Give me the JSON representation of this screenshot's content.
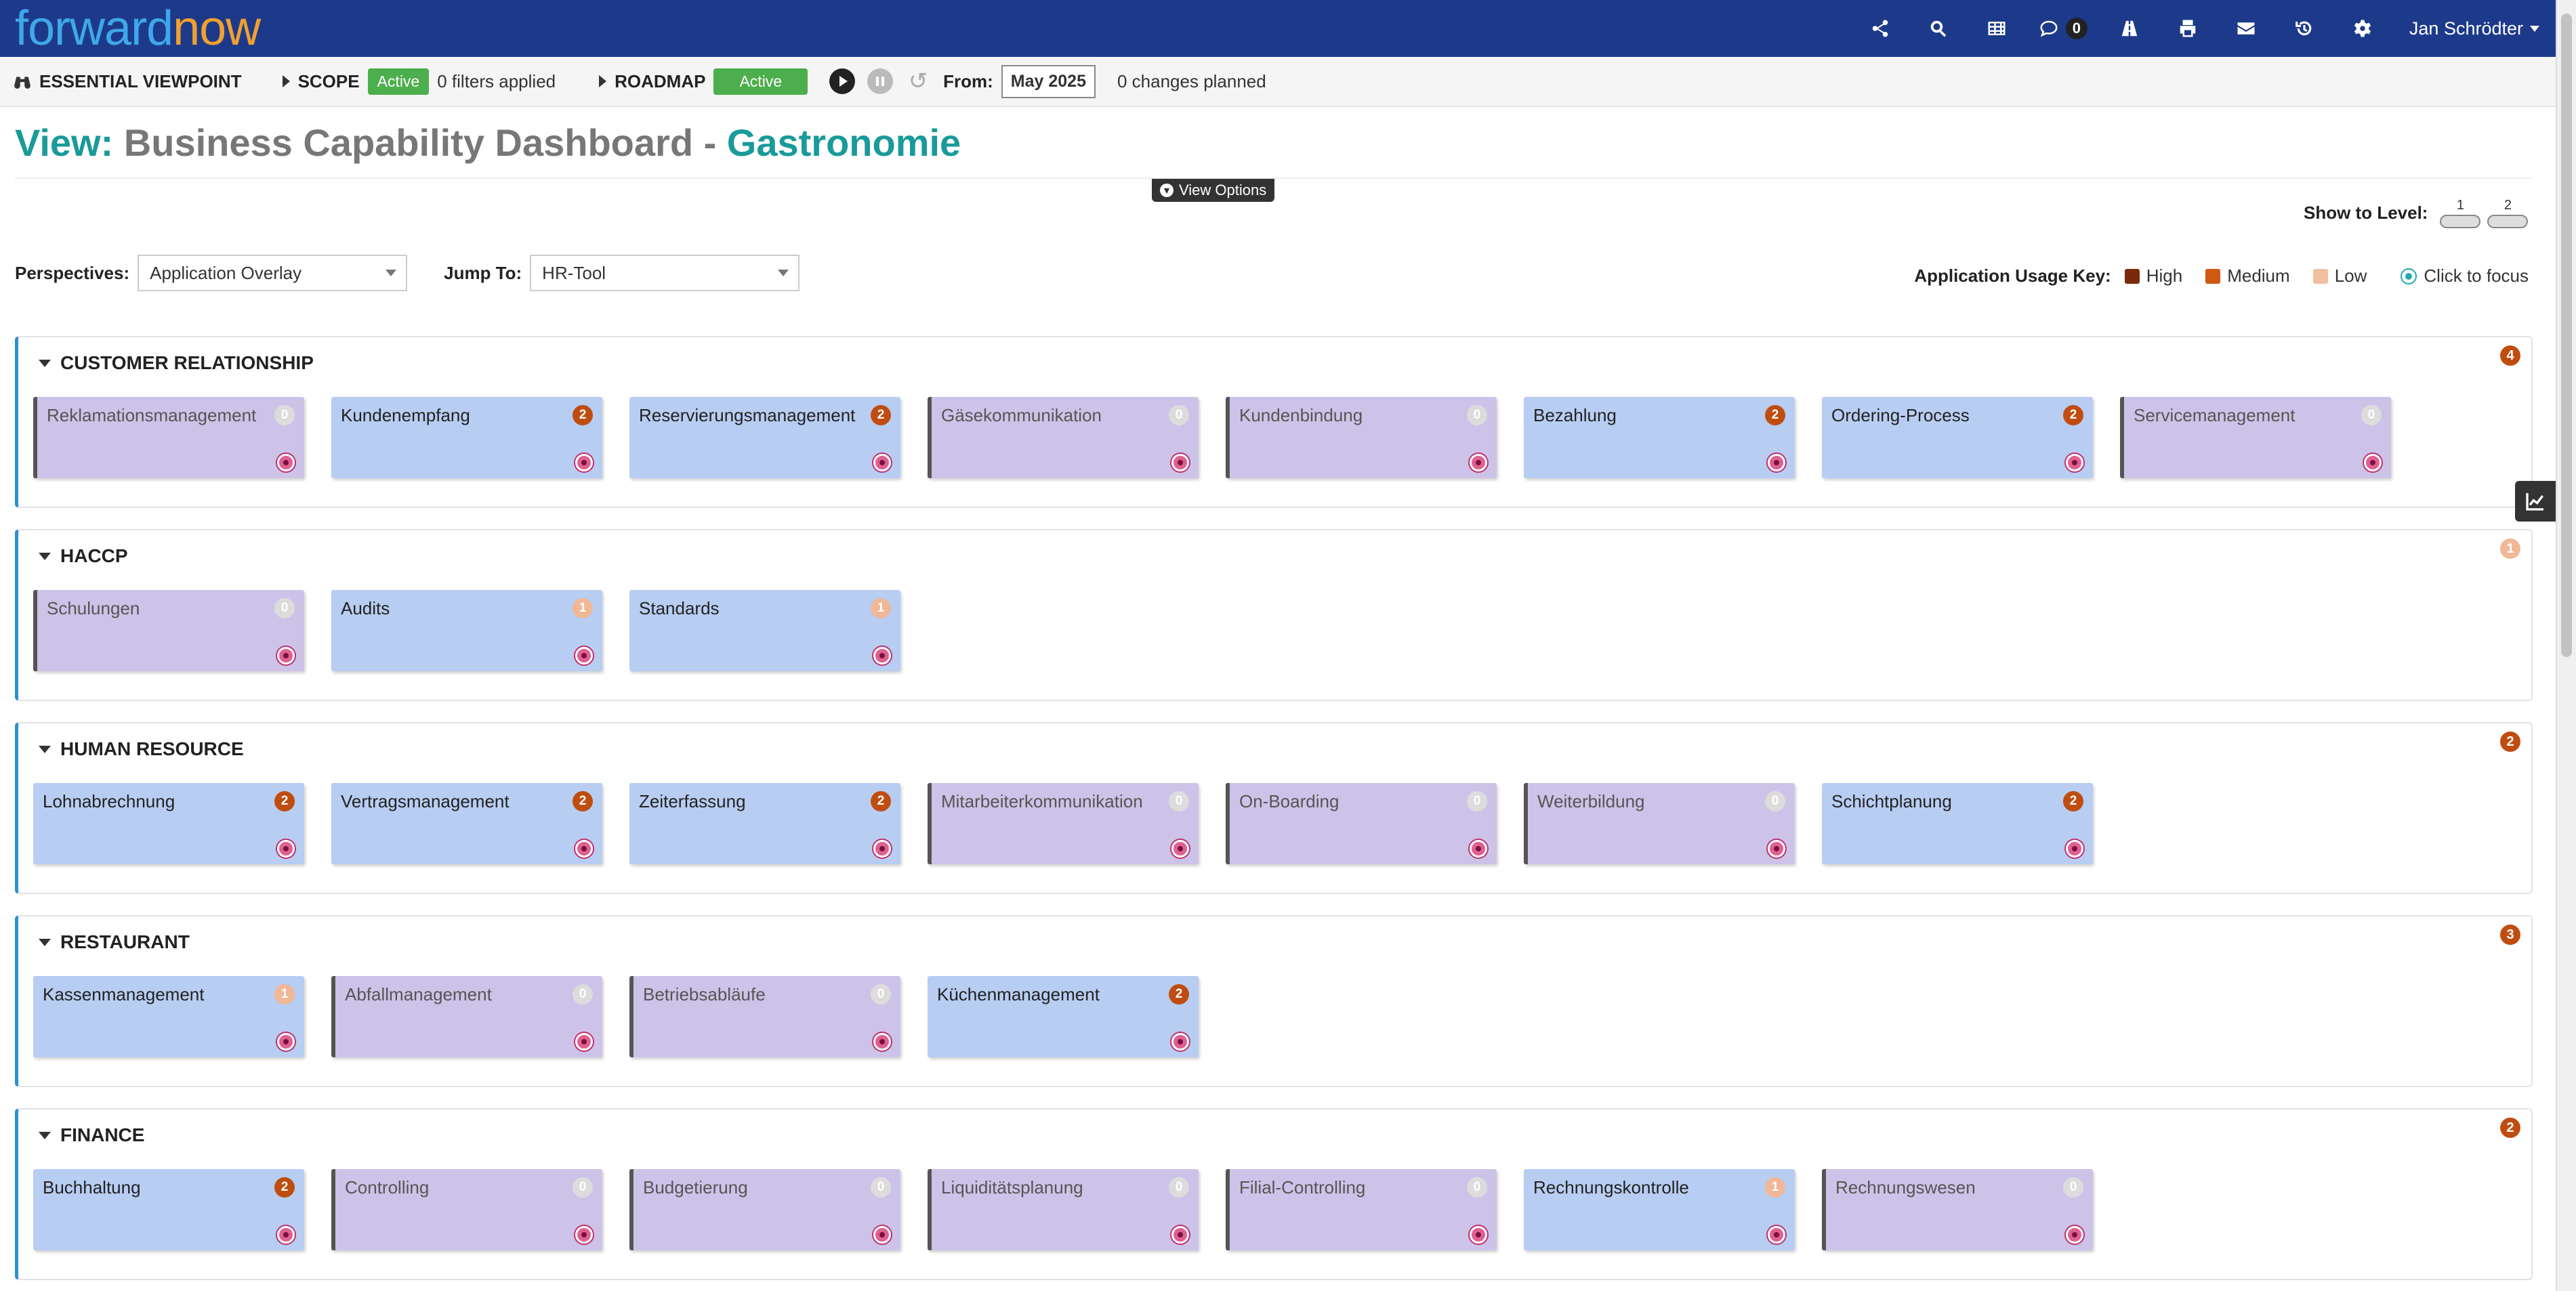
{
  "brand": {
    "part1": "forward",
    "part2": "now"
  },
  "topbar": {
    "icons": [
      "share-icon",
      "search-icon",
      "table-icon",
      "chat-icon",
      "road-icon",
      "print-icon",
      "mail-icon",
      "history-icon",
      "gear-icon"
    ],
    "chat_count": "0",
    "user_name": "Jan Schrödter"
  },
  "toolbar": {
    "viewpoint": "ESSENTIAL VIEWPOINT",
    "scope_label": "SCOPE",
    "scope_status": "Active",
    "filters_text": "0 filters applied",
    "roadmap_label": "ROADMAP",
    "roadmap_status": "Active",
    "from_label": "From:",
    "from_date": "May 2025",
    "changes_text": "0 changes planned"
  },
  "title": {
    "prefix": "View:",
    "name": "Business Capability Dashboard",
    "separator": " - ",
    "context": "Gastronomie"
  },
  "view_options_label": "View Options",
  "show_level": {
    "label": "Show to Level:",
    "levels": [
      "1",
      "2"
    ]
  },
  "filters": {
    "perspectives_label": "Perspectives:",
    "perspectives_value": "Application Overlay",
    "jump_label": "Jump To:",
    "jump_value": "HR-Tool"
  },
  "usage_key": {
    "label": "Application Usage Key:",
    "items": [
      {
        "label": "High",
        "color": "#7a2a0a"
      },
      {
        "label": "Medium",
        "color": "#d05a14"
      },
      {
        "label": "Low",
        "color": "#f0c0a0"
      }
    ],
    "focus_label": "Click to focus"
  },
  "colors": {
    "high": "#7a2a0a",
    "medium": "#c04d10",
    "low": "#f0b896",
    "zero": "#dcdcdc",
    "app": "#b8cdf2",
    "noapp": "#cdc3e8"
  },
  "sections": [
    {
      "title": "CUSTOMER RELATIONSHIP",
      "count": "4",
      "count_color": "#c04d10",
      "cards": [
        {
          "label": "Reklamationsmanagement",
          "count": "0",
          "apps": false
        },
        {
          "label": "Kundenempfang",
          "count": "2",
          "apps": true
        },
        {
          "label": "Reservierungsmanagement",
          "count": "2",
          "apps": true
        },
        {
          "label": "Gäsekommunikation",
          "count": "0",
          "apps": false
        },
        {
          "label": "Kundenbindung",
          "count": "0",
          "apps": false
        },
        {
          "label": "Bezahlung",
          "count": "2",
          "apps": true
        },
        {
          "label": "Ordering-Process",
          "count": "2",
          "apps": true
        },
        {
          "label": "Servicemanagement",
          "count": "0",
          "apps": false
        }
      ]
    },
    {
      "title": "HACCP",
      "count": "1",
      "count_color": "#f0b896",
      "cards": [
        {
          "label": "Schulungen",
          "count": "0",
          "apps": false
        },
        {
          "label": "Audits",
          "count": "1",
          "apps": true
        },
        {
          "label": "Standards",
          "count": "1",
          "apps": true
        }
      ]
    },
    {
      "title": "HUMAN RESOURCE",
      "count": "2",
      "count_color": "#c04d10",
      "cards": [
        {
          "label": "Lohnabrechnung",
          "count": "2",
          "apps": true
        },
        {
          "label": "Vertragsmanagement",
          "count": "2",
          "apps": true
        },
        {
          "label": "Zeiterfassung",
          "count": "2",
          "apps": true
        },
        {
          "label": "Mitarbeiterkommunikation",
          "count": "0",
          "apps": false
        },
        {
          "label": "On-Boarding",
          "count": "0",
          "apps": false
        },
        {
          "label": "Weiterbildung",
          "count": "0",
          "apps": false
        },
        {
          "label": "Schichtplanung",
          "count": "2",
          "apps": true
        }
      ]
    },
    {
      "title": "RESTAURANT",
      "count": "3",
      "count_color": "#c04d10",
      "cards": [
        {
          "label": "Kassenmanagement",
          "count": "1",
          "apps": true
        },
        {
          "label": "Abfallmanagement",
          "count": "0",
          "apps": false
        },
        {
          "label": "Betriebsabläufe",
          "count": "0",
          "apps": false
        },
        {
          "label": "Küchenmanagement",
          "count": "2",
          "apps": true
        }
      ]
    },
    {
      "title": "FINANCE",
      "count": "2",
      "count_color": "#c04d10",
      "cards": [
        {
          "label": "Buchhaltung",
          "count": "2",
          "apps": true
        },
        {
          "label": "Controlling",
          "count": "0",
          "apps": false
        },
        {
          "label": "Budgetierung",
          "count": "0",
          "apps": false
        },
        {
          "label": "Liquiditätsplanung",
          "count": "0",
          "apps": false
        },
        {
          "label": "Filial-Controlling",
          "count": "0",
          "apps": false
        },
        {
          "label": "Rechnungskontrolle",
          "count": "1",
          "apps": true
        },
        {
          "label": "Rechnungswesen",
          "count": "0",
          "apps": false
        }
      ]
    }
  ]
}
